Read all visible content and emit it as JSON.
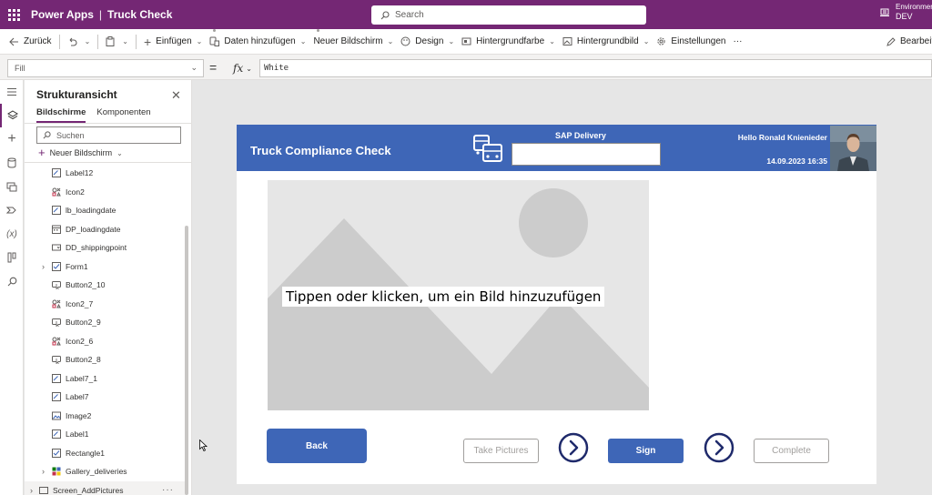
{
  "app": {
    "product": "Power Apps",
    "separator": "|",
    "name": "Truck Check"
  },
  "search": {
    "placeholder": "Search"
  },
  "environment": {
    "label": "Environment",
    "value": "DEV"
  },
  "commands": {
    "back": "Zurück",
    "insert": "Einfügen",
    "add_data": "Daten hinzufügen",
    "new_screen": "Neuer Bildschirm",
    "design": "Design",
    "background_color": "Hintergrundfarbe",
    "background_image": "Hintergrundbild",
    "settings": "Einstellungen",
    "more": "···",
    "edit": "Bearbeiten"
  },
  "formula_bar": {
    "property": "Fill",
    "equals": "=",
    "fx": "fx",
    "formula": "White"
  },
  "tree": {
    "title": "Strukturansicht",
    "tabs": [
      "Bildschirme",
      "Komponenten"
    ],
    "search_placeholder": "Suchen",
    "new_screen": "Neuer Bildschirm",
    "items": [
      {
        "name": "Label12",
        "type": "label"
      },
      {
        "name": "Icon2",
        "type": "icon"
      },
      {
        "name": "lb_loadingdate",
        "type": "label"
      },
      {
        "name": "DP_loadingdate",
        "type": "date"
      },
      {
        "name": "DD_shippingpoint",
        "type": "dropdown"
      },
      {
        "name": "Form1",
        "type": "form"
      },
      {
        "name": "Button2_10",
        "type": "button"
      },
      {
        "name": "Icon2_7",
        "type": "icon"
      },
      {
        "name": "Button2_9",
        "type": "button"
      },
      {
        "name": "Icon2_6",
        "type": "icon"
      },
      {
        "name": "Button2_8",
        "type": "button"
      },
      {
        "name": "Label7_1",
        "type": "label"
      },
      {
        "name": "Label7",
        "type": "label"
      },
      {
        "name": "Image2",
        "type": "image"
      },
      {
        "name": "Label1",
        "type": "label"
      },
      {
        "name": "Rectangle1",
        "type": "rectangle"
      },
      {
        "name": "Gallery_deliveries",
        "type": "gallery"
      }
    ],
    "screen": {
      "name": "Screen_AddPictures",
      "more": "···"
    }
  },
  "canvas": {
    "header_title": "Truck Compliance Check",
    "sap_label": "SAP Delivery",
    "greeting": "Hello Ronald Knienieder",
    "datetime": "14.09.2023 16:35",
    "image_placeholder": "Tippen oder klicken, um ein Bild hinzuzufügen",
    "buttons": {
      "back": "Back",
      "take_pictures": "Take Pictures",
      "sign": "Sign",
      "complete": "Complete"
    }
  },
  "colors": {
    "brand": "#742774",
    "header_blue": "#3e66b7",
    "nav_circle": "#1f2a6b"
  }
}
